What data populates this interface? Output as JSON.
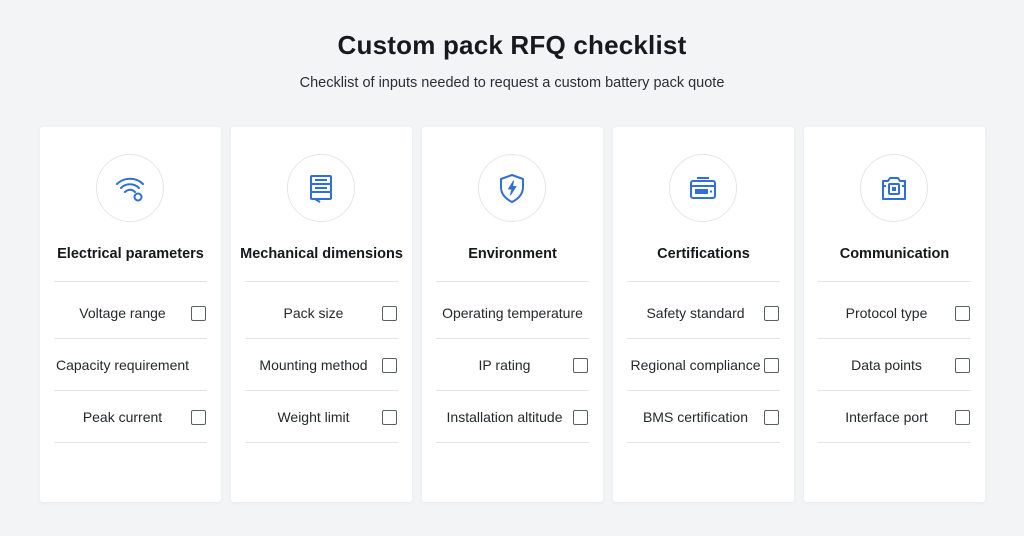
{
  "header": {
    "title": "Custom pack RFQ checklist",
    "subtitle": "Checklist of inputs needed to request a custom battery pack quote"
  },
  "colors": {
    "accent": "#2f6fd6",
    "card_bg": "#ffffff",
    "page_bg": "#f2f4f6"
  },
  "cards": [
    {
      "title": "Electrical parameters",
      "icon": "wifi-signal-icon",
      "items": [
        {
          "label": "Voltage range"
        },
        {
          "label": "Capacity requirement"
        },
        {
          "label": "Peak current"
        }
      ]
    },
    {
      "title": "Mechanical dimensions",
      "icon": "document-stack-icon",
      "items": [
        {
          "label": "Pack size"
        },
        {
          "label": "Mounting method"
        },
        {
          "label": "Weight limit"
        }
      ]
    },
    {
      "title": "Environment",
      "icon": "shield-bolt-icon",
      "items": [
        {
          "label": "Operating temperature"
        },
        {
          "label": "IP rating"
        },
        {
          "label": "Installation altitude"
        }
      ]
    },
    {
      "title": "Certifications",
      "icon": "battery-certificate-icon",
      "items": [
        {
          "label": "Safety standard"
        },
        {
          "label": "Regional compliance"
        },
        {
          "label": "BMS certification"
        }
      ]
    },
    {
      "title": "Communication",
      "icon": "interface-port-icon",
      "items": [
        {
          "label": "Protocol type"
        },
        {
          "label": "Data points"
        },
        {
          "label": "Interface port"
        }
      ]
    }
  ]
}
